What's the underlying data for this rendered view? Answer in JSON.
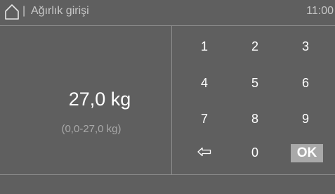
{
  "header": {
    "home_icon": "home-icon",
    "separator": "|",
    "title": "Ağırlık girişi",
    "time": "11:00"
  },
  "display": {
    "weight": "27,0 kg",
    "range": "(0,0-27,0 kg)"
  },
  "keypad": {
    "keys": [
      "1",
      "2",
      "3",
      "4",
      "5",
      "6",
      "7",
      "8",
      "9",
      "0"
    ],
    "backspace_icon": "backspace-arrow-icon",
    "ok_label": "OK"
  },
  "colors": {
    "background": "#5f5f5f",
    "divider": "#8c8c8c",
    "ok_button": "#a9a9a9",
    "muted_text": "#a8a8a8"
  }
}
